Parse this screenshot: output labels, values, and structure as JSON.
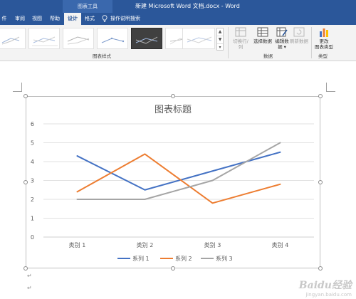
{
  "titlebar": {
    "chart_tools": "图表工具",
    "doc_title": "新建 Microsoft Word 文档.docx  -  Word"
  },
  "tabs": [
    {
      "label": "件",
      "active": false
    },
    {
      "label": "审阅",
      "active": false
    },
    {
      "label": "视图",
      "active": false
    },
    {
      "label": "帮助",
      "active": false
    },
    {
      "label": "设计",
      "active": true
    },
    {
      "label": "格式",
      "active": false
    }
  ],
  "tellme": "操作说明搜索",
  "ribbon": {
    "chart_styles_label": "图表样式",
    "data_label": "数据",
    "type_label": "类型",
    "switch_row_col": "切换行/列",
    "select_data": "选择数据",
    "edit_data_1": "编辑数",
    "edit_data_2": "据 ▾",
    "refresh_data": "刷新数据",
    "change_type_1": "更改",
    "change_type_2": "图表类型"
  },
  "chart_data": {
    "type": "line",
    "title": "图表标题",
    "categories": [
      "类别 1",
      "类别 2",
      "类别 3",
      "类别 4"
    ],
    "series": [
      {
        "name": "系列 1",
        "values": [
          4.3,
          2.5,
          3.5,
          4.5
        ],
        "color": "#4472c4"
      },
      {
        "name": "系列 2",
        "values": [
          2.4,
          4.4,
          1.8,
          2.8
        ],
        "color": "#ed7d31"
      },
      {
        "name": "系列 3",
        "values": [
          2,
          2,
          3,
          5
        ],
        "color": "#a5a5a5"
      }
    ],
    "ylim": [
      0,
      6
    ],
    "yticks": [
      "0",
      "1",
      "2",
      "3",
      "4",
      "5",
      "6"
    ],
    "grid": true,
    "legend": "bottom"
  },
  "watermark": {
    "logo": "Baidu经验",
    "url": "jingyan.baidu.com"
  }
}
